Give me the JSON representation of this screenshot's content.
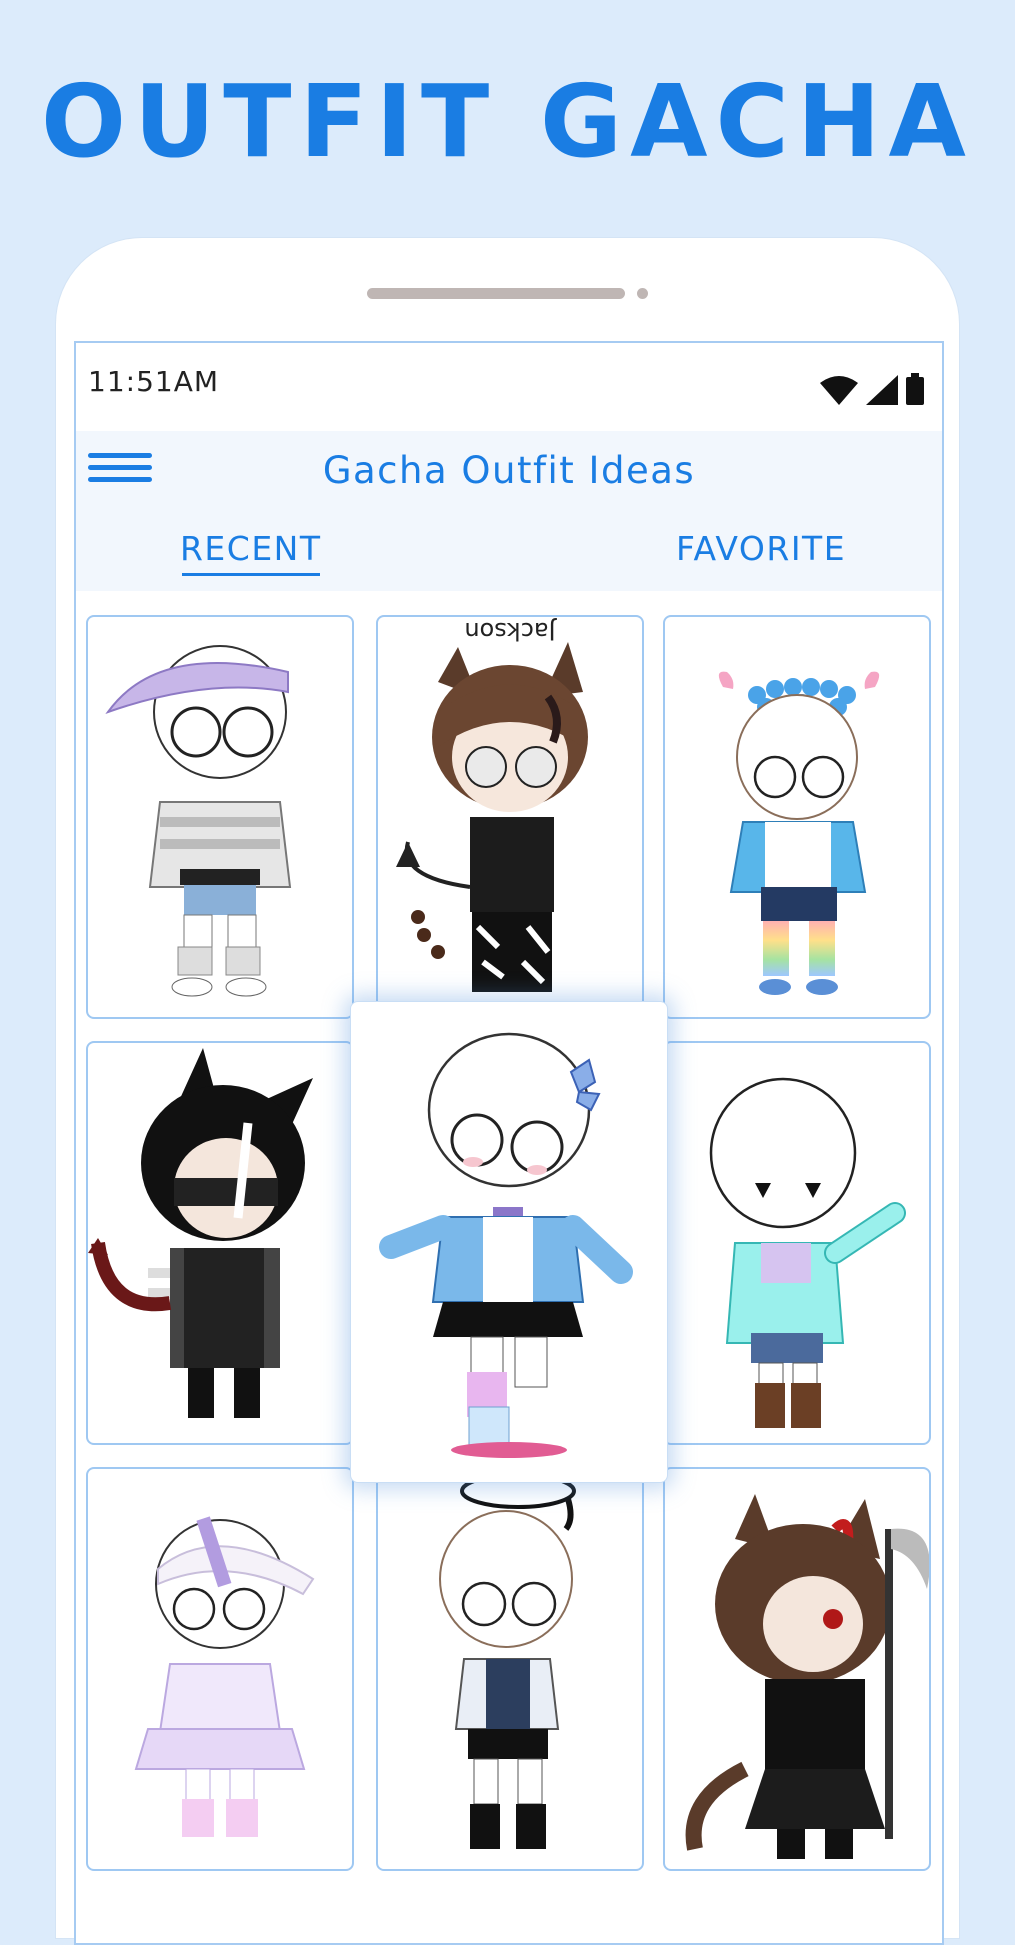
{
  "promo": {
    "title": "OUTFIT GACHA"
  },
  "status": {
    "time": "11:51AM"
  },
  "app": {
    "title": "Gacha Outfit Ideas"
  },
  "tabs": {
    "recent": "RECENT",
    "favorite": "FAVORITE",
    "active": "RECENT"
  },
  "icons": {
    "menu": "hamburger-menu-icon",
    "wifi": "wifi-icon",
    "signal": "signal-icon",
    "battery": "battery-icon"
  },
  "colors": {
    "accent": "#1a7de3",
    "background": "#dcebfb",
    "card_border": "#9fc8f2"
  },
  "cards": [
    {
      "name": "outfit-lilac-visor-striped-hoodie"
    },
    {
      "name": "outfit-brown-hair-cat-ears-demon-tail",
      "caption": "Jackson"
    },
    {
      "name": "outfit-flower-crown-blue-shirt-rainbow-socks"
    },
    {
      "name": "outfit-black-hair-cat-ears-mask-dragon-tail"
    },
    {
      "name": "outfit-blue-jacket-butterfly-clip"
    },
    {
      "name": "outfit-mint-jacket-brown-boots"
    },
    {
      "name": "outfit-white-visor-lilac-dress"
    },
    {
      "name": "outfit-halo-black-vest"
    },
    {
      "name": "outfit-brown-hair-horn-scythe"
    }
  ]
}
